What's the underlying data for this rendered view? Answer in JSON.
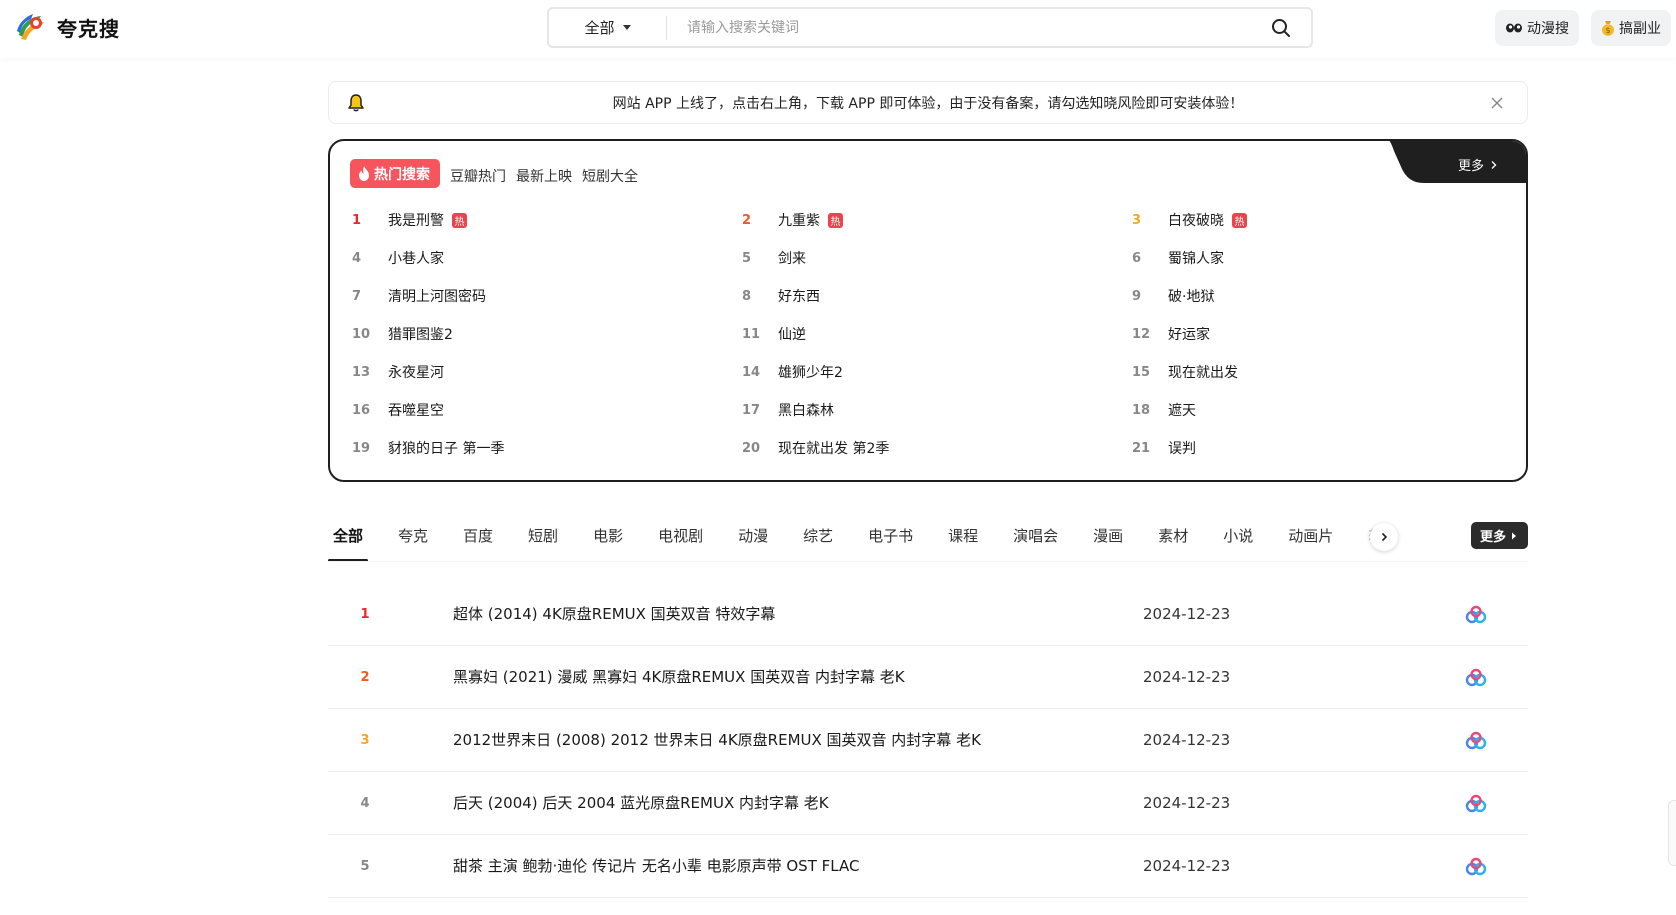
{
  "app": {
    "name": "夸克搜"
  },
  "search": {
    "scope": "全部",
    "placeholder": "请输入搜索关键词",
    "value": ""
  },
  "header_buttons": [
    {
      "label": "动漫搜",
      "icon": "glasses-icon"
    },
    {
      "label": "搞副业",
      "icon": "money-bag-icon"
    }
  ],
  "notice": {
    "text": "网站 APP 上线了，点击右上角，下载 APP 即可体验，由于没有备案，请勾选知晓风险即可安装体验！"
  },
  "hot_search": {
    "badge": "热门搜索",
    "links": [
      "豆瓣热门",
      "最新上映",
      "短剧大全"
    ],
    "more": "更多",
    "hot_tag": "热",
    "items": [
      {
        "rank": "1",
        "title": "我是刑警",
        "hot": true
      },
      {
        "rank": "2",
        "title": "九重紫",
        "hot": true
      },
      {
        "rank": "3",
        "title": "白夜破晓",
        "hot": true
      },
      {
        "rank": "4",
        "title": "小巷人家",
        "hot": false
      },
      {
        "rank": "5",
        "title": "剑来",
        "hot": false
      },
      {
        "rank": "6",
        "title": "蜀锦人家",
        "hot": false
      },
      {
        "rank": "7",
        "title": "清明上河图密码",
        "hot": false
      },
      {
        "rank": "8",
        "title": "好东西",
        "hot": false
      },
      {
        "rank": "9",
        "title": "破·地狱",
        "hot": false
      },
      {
        "rank": "10",
        "title": "猎罪图鉴2",
        "hot": false
      },
      {
        "rank": "11",
        "title": "仙逆",
        "hot": false
      },
      {
        "rank": "12",
        "title": "好运家",
        "hot": false
      },
      {
        "rank": "13",
        "title": "永夜星河",
        "hot": false
      },
      {
        "rank": "14",
        "title": "雄狮少年2",
        "hot": false
      },
      {
        "rank": "15",
        "title": "现在就出发",
        "hot": false
      },
      {
        "rank": "16",
        "title": "吞噬星空",
        "hot": false
      },
      {
        "rank": "17",
        "title": "黑白森林",
        "hot": false
      },
      {
        "rank": "18",
        "title": "遮天",
        "hot": false
      },
      {
        "rank": "19",
        "title": "豺狼的日子 第一季",
        "hot": false
      },
      {
        "rank": "20",
        "title": "现在就出发 第2季",
        "hot": false
      },
      {
        "rank": "21",
        "title": "误判",
        "hot": false
      }
    ]
  },
  "tabs": {
    "items": [
      "全部",
      "夸克",
      "百度",
      "短剧",
      "电影",
      "电视剧",
      "动漫",
      "综艺",
      "电子书",
      "课程",
      "演唱会",
      "漫画",
      "素材",
      "小说",
      "动画片",
      "软件"
    ],
    "active": "全部",
    "more": "更多"
  },
  "results": [
    {
      "rank": "1",
      "title": "超体 (2014) 4K原盘REMUX 国英双音 特效字幕",
      "date": "2024-12-23"
    },
    {
      "rank": "2",
      "title": "黑寡妇 (2021) 漫威 黑寡妇 4K原盘REMUX 国英双音 内封字幕 老K",
      "date": "2024-12-23"
    },
    {
      "rank": "3",
      "title": "2012世界末日 (2008) 2012 世界末日 4K原盘REMUX 国英双音 内封字幕 老K",
      "date": "2024-12-23"
    },
    {
      "rank": "4",
      "title": "后天 (2004) 后天 2004 蓝光原盘REMUX 内封字幕 老K",
      "date": "2024-12-23"
    },
    {
      "rank": "5",
      "title": "甜茶 主演 鲍勃·迪伦 传记片 无名小辈 电影原声带 OST FLAC",
      "date": "2024-12-23"
    }
  ],
  "colors": {
    "rank1": "#f0262e",
    "rank2": "#f15a24",
    "rank3": "#f5a623",
    "hot_badge": "#f7555d",
    "dark": "#1f1f1f"
  }
}
